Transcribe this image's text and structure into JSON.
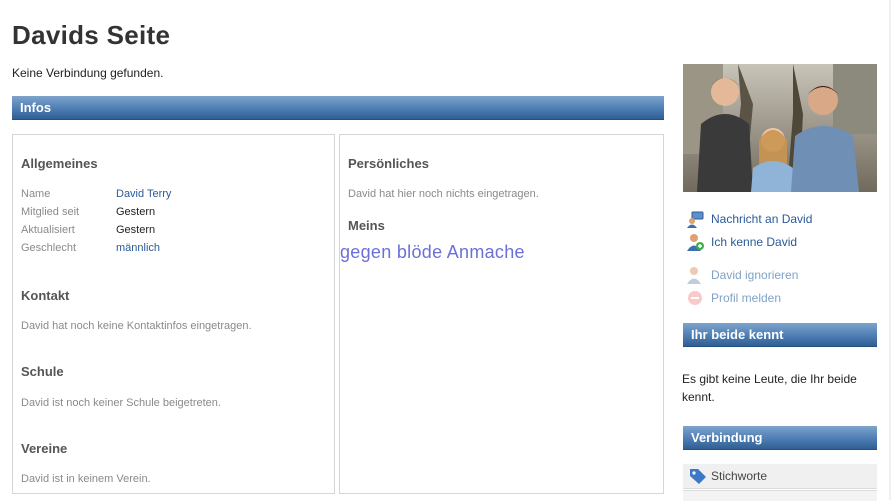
{
  "page": {
    "title": "Davids Seite",
    "status": "Keine Verbindung gefunden."
  },
  "infos": {
    "header": "Infos",
    "general": {
      "heading": "Allgemeines",
      "rows": [
        {
          "label": "Name",
          "value": "David Terry"
        },
        {
          "label": "Mitglied seit",
          "value": "Gestern"
        },
        {
          "label": "Aktualisiert",
          "value": "Gestern"
        },
        {
          "label": "Geschlecht",
          "value": "männlich"
        }
      ]
    },
    "contact": {
      "heading": "Kontakt",
      "text": "David hat noch keine Kontaktinfos eingetragen."
    },
    "school": {
      "heading": "Schule",
      "text": "David ist noch keiner Schule beigetreten."
    },
    "clubs": {
      "heading": "Vereine",
      "text": "David ist in keinem Verein."
    },
    "personal": {
      "heading": "Persönliches",
      "text": "David hat hier noch nichts eingetragen."
    },
    "mine": {
      "heading": "Meins",
      "overlay": "gegen blöde Anmache"
    }
  },
  "sidebar": {
    "actions": [
      {
        "label": "Nachricht an David",
        "icon": "message-icon"
      },
      {
        "label": "Ich kenne David",
        "icon": "add-contact-icon"
      },
      {
        "label": "David ignorieren",
        "icon": "ignore-user-icon"
      },
      {
        "label": "Profil melden",
        "icon": "report-icon"
      }
    ],
    "mutual": {
      "header": "Ihr beide kennt",
      "text": "Es gibt keine Leute, die Ihr beide kennt."
    },
    "connection": {
      "header": "Verbindung",
      "tag_label": "Stichworte",
      "tag_icon": "tag-icon"
    }
  },
  "colors": {
    "bar": "#4d7eb3",
    "link": "#2a5a98",
    "overlay": "#6b70d8"
  }
}
